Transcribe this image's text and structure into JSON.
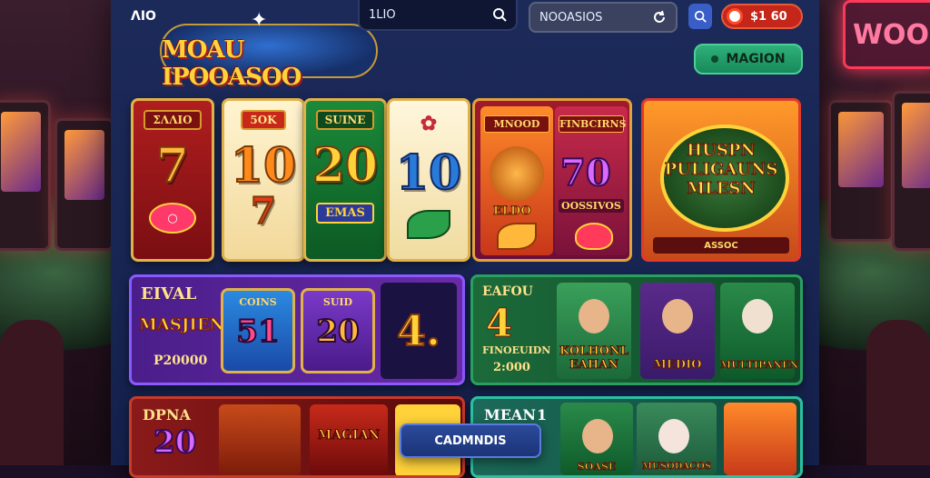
{
  "header": {
    "mini_logo": "ΛΙΟ",
    "logo_text": "MOAU IPOOASOO",
    "search1_value": "1LIO",
    "search2_value": "NOOASIOS",
    "balance": "$1 60",
    "cta_label": "MAGION"
  },
  "reels": [
    {
      "tag": "ΣΛΛΙΟ",
      "number": "7",
      "bottom": "○"
    },
    {
      "tag": "5OK",
      "number": "10",
      "bottom": "7"
    },
    {
      "tag": "SUINE",
      "number": "20",
      "bottom": "EMAS"
    },
    {
      "tag": "✿",
      "number": "10",
      "bottom": ""
    }
  ],
  "slot_a": {
    "left_label": "MNOOD",
    "left_name": "ELDO",
    "right_label": "FINBCIRNS",
    "right_number": "70",
    "right_sub": "OOSSIVOS"
  },
  "promo": {
    "title": "HUSPN PULIGAUNS MLESN",
    "footer": "ASSOC"
  },
  "row2": {
    "purple": {
      "label": "EIVAL",
      "name": "MASJIEN",
      "amount": "P20000",
      "reel1_tag": "COINS",
      "reel1_num": "51",
      "reel2_tag": "SUID",
      "reel2_num": "20",
      "big": "4."
    },
    "green": {
      "label": "EAFOU",
      "num": "4",
      "sub": "FINOEUIDN",
      "amount": "2:000",
      "char1": "KOLHONL EAHAN",
      "char2": "MEDIO",
      "char3": "MULTIPANEN"
    }
  },
  "row3": {
    "red": {
      "label": "DPNA",
      "num": "20",
      "logo": "MAGIAN"
    },
    "teal": {
      "label": "MEAN",
      "num": "1",
      "char1": "SOASE",
      "char2": "MUSODACOS"
    }
  },
  "popup_label": "CADMNDIS"
}
